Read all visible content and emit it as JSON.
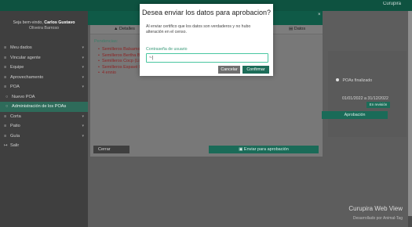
{
  "app": {
    "brand": "Curupira"
  },
  "sidebar": {
    "welcome_prefix": "Seja bem-vindo,",
    "user_name": "Carlos Gustavo",
    "user_sub": "Oliveira Barroso",
    "items": [
      {
        "icon": "≡",
        "label": "Meu dados",
        "chevron": true
      },
      {
        "icon": "≡",
        "label": "Vincular agente",
        "chevron": true
      },
      {
        "icon": "≡",
        "label": "Equipe",
        "chevron": true
      },
      {
        "icon": "≡",
        "label": "Aprovechamento",
        "chevron": true
      },
      {
        "icon": "≡",
        "label": "POA",
        "chevron": true
      },
      {
        "icon": "○",
        "label": "Nuevo POA",
        "chevron": false,
        "sub": true
      },
      {
        "icon": "○",
        "label": "Administración de los POAs",
        "chevron": false,
        "sub": true,
        "active": true
      },
      {
        "icon": "≡",
        "label": "Corta",
        "chevron": true
      },
      {
        "icon": "≡",
        "label": "Patio",
        "chevron": true
      },
      {
        "icon": "≡",
        "label": "Guía",
        "chevron": true
      },
      {
        "icon": "↦",
        "label": "Salir",
        "chevron": false
      }
    ]
  },
  "card": {
    "tab_left": "Detalles",
    "tab_right": "Datos",
    "pendencias_title": "Pendencias:",
    "pendencias": [
      "Semilleros Balsamo",
      "Semilleros Bertha Bl",
      "Semilleros Cocp (Li",
      "Semilleros Espavé I",
      "4 ennio"
    ],
    "close_button": "Cerrar",
    "send_button": "Enviar para aprobación"
  },
  "right_panel": {
    "status": "POAs finalizado",
    "date_range": "01/01/2022 a 31/12/2022",
    "tag": "En revisión",
    "approve_button": "Aprobación"
  },
  "footer": {
    "title": "Curupira Web View",
    "subtitle": "Desarrollado por Animal-Tag"
  },
  "modal": {
    "title": "Desea enviar los datos para aprobacion?",
    "text": "Al enviar certifico que los datos son verdaderos y no hubo alteración en el censo.",
    "password_label": "Contraseña de usuario",
    "password_value": "~|",
    "cancel_label": "Cancelar",
    "confirm_label": "Confirmar",
    "close_symbol": "×"
  },
  "colors": {
    "primary": "#1d6d59",
    "topbar": "#0e5240",
    "input_border": "#49c6a0",
    "pending": "#8c2323"
  }
}
